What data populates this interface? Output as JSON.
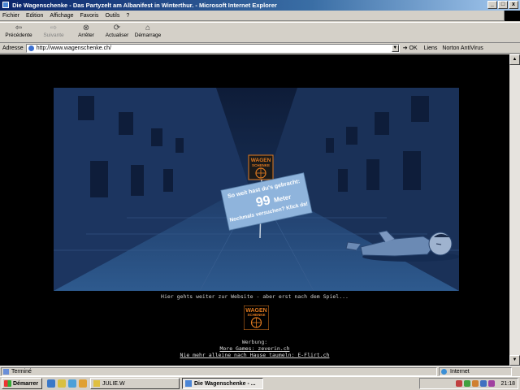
{
  "window": {
    "title": "Die Wagenschenke - Das Partyzelt am Albanifest in Winterthur. - Microsoft Internet Explorer",
    "controls": [
      "_",
      "□",
      "x"
    ]
  },
  "menu": [
    "Fichier",
    "Edition",
    "Affichage",
    "Favoris",
    "Outils",
    "?"
  ],
  "toolbar": {
    "back": "Précédente",
    "forward": "Suivante",
    "stop": "Arrêter",
    "refresh": "Actualiser",
    "home": "Démarrage"
  },
  "address": {
    "label": "Adresse",
    "url": "http://www.wagenschenke.ch/",
    "go": "OK",
    "links": "Liens",
    "norton": "Norton AntiVirus"
  },
  "page": {
    "sign_logo": [
      "WAGEN",
      "SCHENKE"
    ],
    "sign_lines": [
      "So weit hast du's gebracht:",
      "99",
      "Meter",
      "Nochmals versuchen? Klick da!"
    ],
    "caption": "Hier gehts weiter zur Website - aber erst nach dem Spiel...",
    "logo_text": [
      "WAGEN",
      "SCHENKE"
    ],
    "ad_label": "Werbung:",
    "ad_links": [
      "More Games: zeverin.ch",
      "Nie mehr alleine nach Hause taumeln: E-Flirt.ch"
    ]
  },
  "status": {
    "text": "Terminé",
    "zone": "Internet"
  },
  "taskbar": {
    "start": "Démarrer",
    "tasks": [
      "JULIE.W",
      "Die Wagenschenke - ..."
    ],
    "clock": "21:18"
  },
  "colors": {
    "title_start": "#0a246a",
    "scene_bg": "#1a3458",
    "sign": "#8fb4dc",
    "logo_orange": "#e07a20"
  }
}
